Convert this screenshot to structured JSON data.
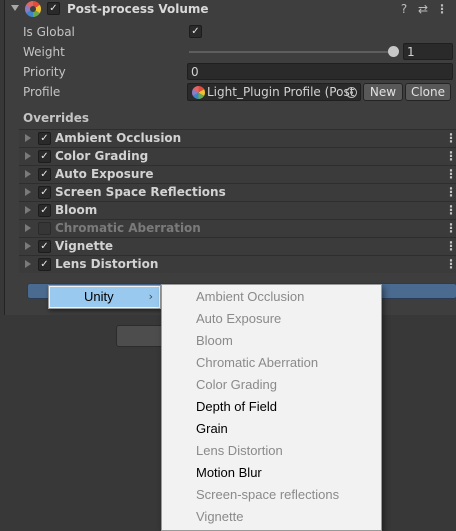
{
  "component": {
    "title": "Post-process Volume",
    "enabled": "✓",
    "header_icons": {
      "help": "?",
      "preset": "⇄",
      "menu": "⋮"
    }
  },
  "properties": {
    "is_global": {
      "label": "Is Global",
      "value": "✓"
    },
    "weight": {
      "label": "Weight",
      "value": "1",
      "slider_fraction": 1.0
    },
    "priority": {
      "label": "Priority",
      "value": "0"
    },
    "profile": {
      "label": "Profile",
      "value": "Light_Plugin Profile (Post",
      "new_button": "New",
      "clone_button": "Clone"
    }
  },
  "overrides": {
    "label": "Overrides",
    "items": [
      {
        "label": "Ambient Occlusion",
        "checked": "✓",
        "dimmed": false
      },
      {
        "label": "Color Grading",
        "checked": "✓",
        "dimmed": false
      },
      {
        "label": "Auto Exposure",
        "checked": "✓",
        "dimmed": false
      },
      {
        "label": "Screen Space Reflections",
        "checked": "✓",
        "dimmed": false
      },
      {
        "label": "Bloom",
        "checked": "✓",
        "dimmed": false
      },
      {
        "label": "Chromatic Aberration",
        "checked": "",
        "dimmed": true
      },
      {
        "label": "Vignette",
        "checked": "✓",
        "dimmed": false
      },
      {
        "label": "Lens Distortion",
        "checked": "✓",
        "dimmed": false
      }
    ],
    "row_menu_glyph": "⋮"
  },
  "context_menu": {
    "root_item": {
      "label": "Unity",
      "arrow": "›"
    },
    "submenu": [
      {
        "label": "Ambient Occlusion",
        "enabled": false
      },
      {
        "label": "Auto Exposure",
        "enabled": false
      },
      {
        "label": "Bloom",
        "enabled": false
      },
      {
        "label": "Chromatic Aberration",
        "enabled": false
      },
      {
        "label": "Color Grading",
        "enabled": false
      },
      {
        "label": "Depth of Field",
        "enabled": true
      },
      {
        "label": "Grain",
        "enabled": true
      },
      {
        "label": "Lens Distortion",
        "enabled": false
      },
      {
        "label": "Motion Blur",
        "enabled": true
      },
      {
        "label": "Screen-space reflections",
        "enabled": false
      },
      {
        "label": "Vignette",
        "enabled": false
      }
    ]
  },
  "colors": {
    "panel_bg": "#3e3e3e",
    "menu_bg": "#f2f2f2",
    "menu_highlight": "#99c9ef",
    "add_bar": "#4a6a8f"
  }
}
